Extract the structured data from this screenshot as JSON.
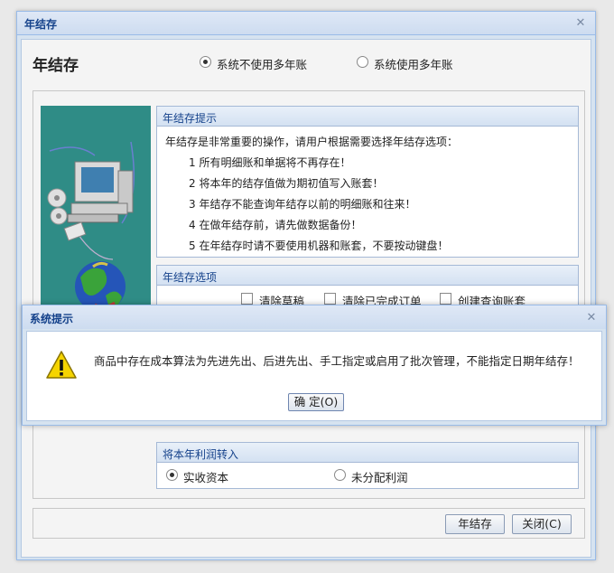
{
  "window": {
    "title": "年结存",
    "heading": "年结存",
    "radio_options": [
      {
        "label": "系统不使用多年账",
        "selected": true
      },
      {
        "label": "系统使用多年账",
        "selected": false
      }
    ]
  },
  "hint_panel": {
    "title": "年结存提示",
    "intro": "年结存是非常重要的操作，请用户根据需要选择年结存选项：",
    "items": [
      "1 所有明细账和单据将不再存在！",
      "2 将本年的结存值做为期初值写入账套！",
      "3 年结存不能查询年结存以前的明细账和往来！",
      "4 在做年结存前，请先做数据备份！",
      "5 在年结存时请不要使用机器和账套，不要按动键盘！"
    ]
  },
  "options_panel": {
    "title": "年结存选项",
    "checkboxes": [
      {
        "label": "清除草稿",
        "checked": false
      },
      {
        "label": "清除已完成订单",
        "checked": false
      },
      {
        "label": "创建查询账套",
        "checked": false
      }
    ]
  },
  "profit_panel": {
    "title": "将本年利润转入",
    "radio_options": [
      {
        "label": "实收资本",
        "selected": true
      },
      {
        "label": "未分配利润",
        "selected": false
      }
    ]
  },
  "buttons": {
    "year_close": "年结存",
    "close": "关闭(C)"
  },
  "dialog": {
    "title": "系统提示",
    "message": "商品中存在成本算法为先进先出、后进先出、手工指定或启用了批次管理，不能指定日期年结存！",
    "ok_label": "确 定(O)"
  },
  "icons": {
    "close": "close-icon",
    "warning": "warning-icon"
  },
  "colors": {
    "title_text": "#15428b",
    "image_bg": "#2f8c86",
    "warning_yellow": "#f5d400"
  }
}
